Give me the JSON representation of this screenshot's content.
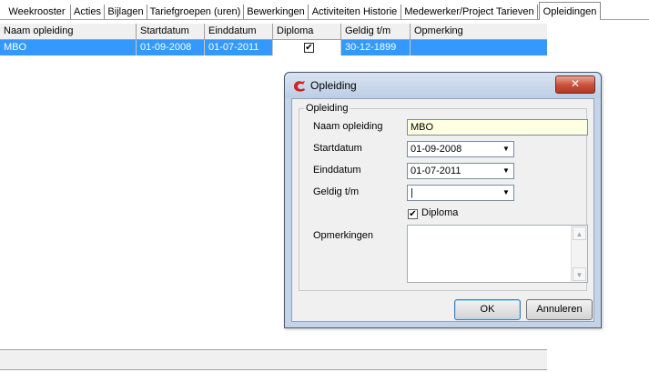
{
  "tabs": [
    {
      "label": "Weekrooster"
    },
    {
      "label": "Acties"
    },
    {
      "label": "Bijlagen"
    },
    {
      "label": "Tariefgroepen (uren)"
    },
    {
      "label": "Bewerkingen"
    },
    {
      "label": "Activiteiten Historie"
    },
    {
      "label": "Medewerker/Project Tarieven"
    },
    {
      "label": "Opleidingen"
    }
  ],
  "grid": {
    "columns": [
      "Naam opleiding",
      "Startdatum",
      "Einddatum",
      "Diploma",
      "Geldig t/m",
      "Opmerking"
    ],
    "rows": [
      {
        "naam": "MBO",
        "start": "01-09-2008",
        "eind": "01-07-2011",
        "diploma": "✔",
        "geldig": "30-12-1899",
        "opmerking": ""
      }
    ]
  },
  "dialog": {
    "title": "Opleiding",
    "group_label": "Opleiding",
    "fields": {
      "naam": {
        "label": "Naam opleiding",
        "value": "MBO"
      },
      "start": {
        "label": "Startdatum",
        "value": "01-09-2008"
      },
      "eind": {
        "label": "Einddatum",
        "value": "01-07-2011"
      },
      "geldig": {
        "label": "Geldig t/m",
        "value": "|"
      },
      "diploma": {
        "label": "Diploma",
        "checked": true,
        "mark": "✔"
      },
      "opmerkingen": {
        "label": "Opmerkingen",
        "value": ""
      }
    },
    "ok_label": "OK",
    "cancel_label": "Annuleren",
    "close_glyph": "✕",
    "dropdown_glyph": "▼",
    "scroll_up_glyph": "▲",
    "scroll_down_glyph": "▼"
  },
  "colors": {
    "selection": "#3399ff",
    "field_highlight": "#ffffe1",
    "close_button": "#c84f37",
    "app_icon": "#d42222"
  }
}
